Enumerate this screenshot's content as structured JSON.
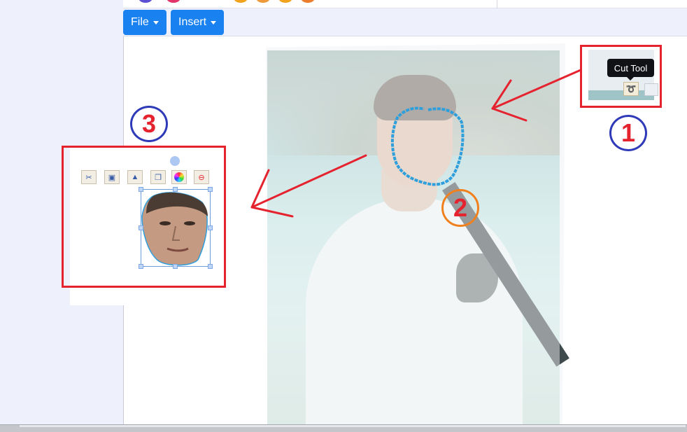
{
  "menu": {
    "file_label": "File",
    "insert_label": "Insert"
  },
  "tooltip": {
    "text": "Cut Tool"
  },
  "annotations": {
    "step1": "1",
    "step2": "2",
    "step3": "3"
  },
  "result_toolbar": [
    "scissors-off-icon",
    "layer-back-icon",
    "flip-icon",
    "copy-icon",
    "color-wheel-icon",
    "delete-icon"
  ],
  "colors": {
    "annotation_red": "#e5232f",
    "annotation_blue": "#2e3ab7",
    "annotation_orange": "#f0801e",
    "button_blue": "#1a82f0",
    "lasso_blue": "#2f9fdc"
  }
}
